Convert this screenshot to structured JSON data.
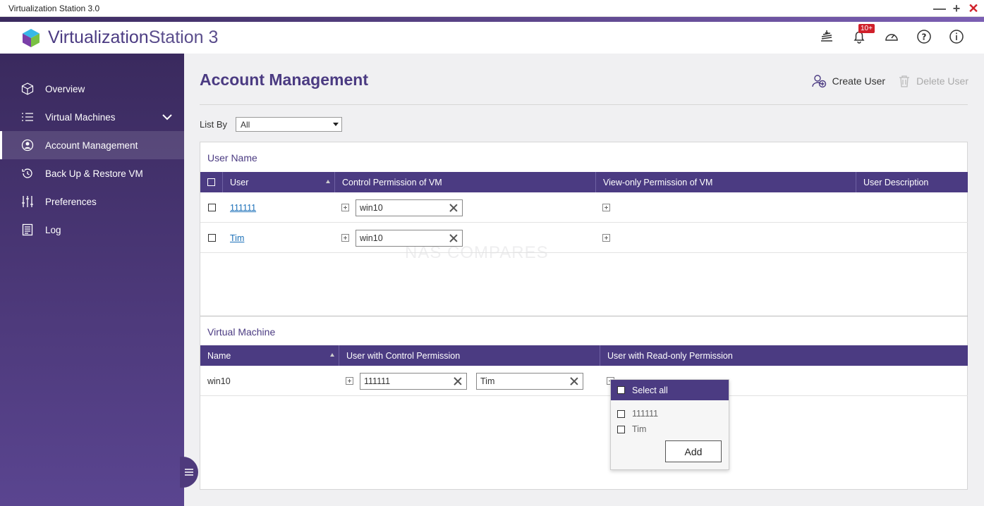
{
  "window": {
    "title": "Virtualization Station 3.0"
  },
  "brand": {
    "name_bold": "Virtualization",
    "name_light": "Station 3"
  },
  "header": {
    "notification_badge": "10+"
  },
  "sidebar": {
    "items": [
      {
        "label": "Overview",
        "icon": "overview-cube-icon"
      },
      {
        "label": "Virtual Machines",
        "icon": "list-icon"
      },
      {
        "label": "Account Management",
        "icon": "user-circle-icon"
      },
      {
        "label": "Back Up & Restore VM",
        "icon": "backup-icon"
      },
      {
        "label": "Preferences",
        "icon": "sliders-icon"
      },
      {
        "label": "Log",
        "icon": "log-icon"
      }
    ]
  },
  "page": {
    "title": "Account Management",
    "create_user": "Create User",
    "delete_user": "Delete User"
  },
  "filter": {
    "label": "List By",
    "value": "All"
  },
  "users_section": {
    "title": "User Name",
    "columns": [
      "User",
      "Control Permission of VM",
      "View-only Permission of VM",
      "User Description"
    ],
    "rows": [
      {
        "user": "111111",
        "control_vm": "win10"
      },
      {
        "user": "Tim",
        "control_vm": "win10"
      }
    ]
  },
  "vm_section": {
    "title": "Virtual Machine",
    "columns": [
      "Name",
      "User with Control Permission",
      "User with Read-only Permission"
    ],
    "rows": [
      {
        "name": "win10",
        "control_users": [
          "111111",
          "Tim"
        ]
      }
    ]
  },
  "popup": {
    "select_all": "Select all",
    "options": [
      "111111",
      "Tim"
    ],
    "add_button": "Add"
  },
  "watermark": "NAS COMPARES",
  "colors": {
    "accent": "#4b3b82",
    "sidebar": "#3a2a5e",
    "link": "#1a6fb8",
    "close": "#d0202a"
  }
}
